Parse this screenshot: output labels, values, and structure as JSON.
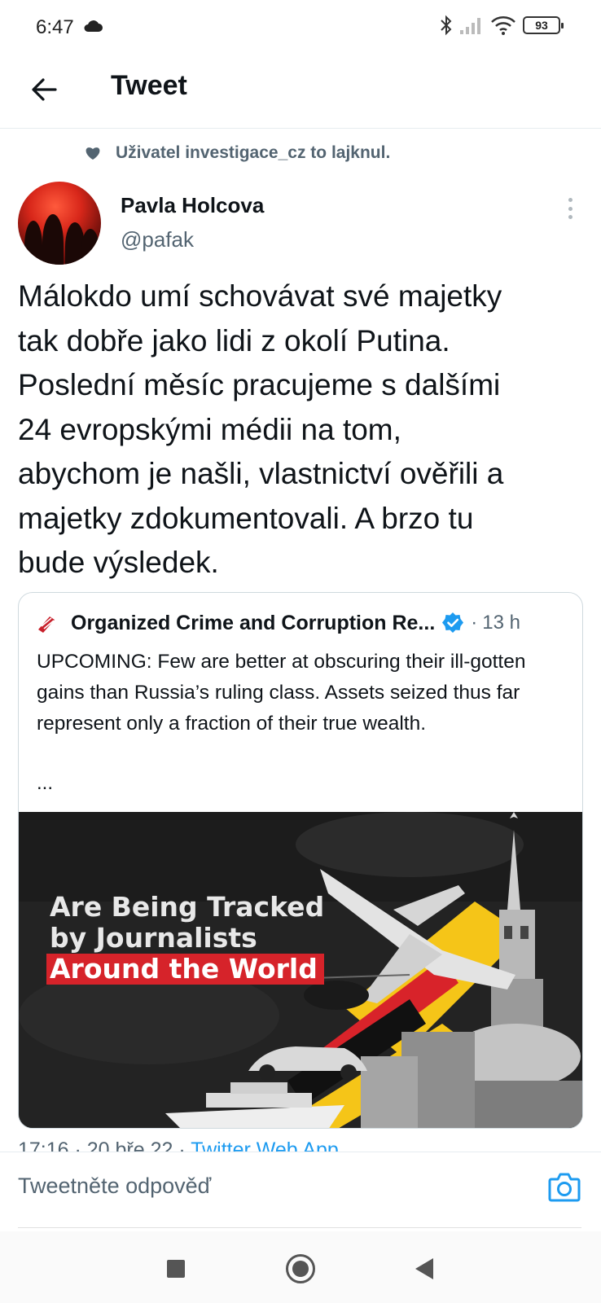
{
  "status_bar": {
    "time": "6:47",
    "battery": "93",
    "icons": [
      "cloud-icon",
      "bluetooth-icon",
      "signal-icon",
      "wifi-icon",
      "battery-icon"
    ]
  },
  "header": {
    "title": "Tweet",
    "back_icon": "arrow-left-icon"
  },
  "social_context": {
    "icon": "heart-icon",
    "text": "Uživatel investigace_cz to lajknul."
  },
  "tweet": {
    "author_name": "Pavla Holcova",
    "author_handle": "@pafak",
    "text": "Málokdo umí schovávat své majetky\ntak dobře jako lidi z okolí Putina.\nPoslední měsíc pracujeme s dalšími\n24 evropskými médii na tom,\nabychom je našli, vlastnictví ověřili a\nmajetky zdokumentovali. A brzo tu\nbude výsledek.",
    "meta_time": "17:16 · 20 bře 22 · ",
    "meta_source": "Twitter Web App"
  },
  "quote": {
    "author": "Organized Crime and Corruption Re...",
    "dot": "·",
    "time": "13 h",
    "text": "UPCOMING: Few are better at obscuring their ill-gotten gains than Russia’s ruling class. Assets seized thus far represent only a fraction of their true wealth.",
    "ellipsis": "...",
    "image": {
      "line1": "Are Being Tracked",
      "line2": "by Journalists",
      "line3": "Around the World"
    }
  },
  "reply": {
    "placeholder": "Tweetněte odpověď"
  },
  "colors": {
    "accent": "#1d9bf0",
    "secondary_text": "#536471",
    "highlight_red": "#d6232a",
    "ukraine_yellow": "#f5c518"
  }
}
